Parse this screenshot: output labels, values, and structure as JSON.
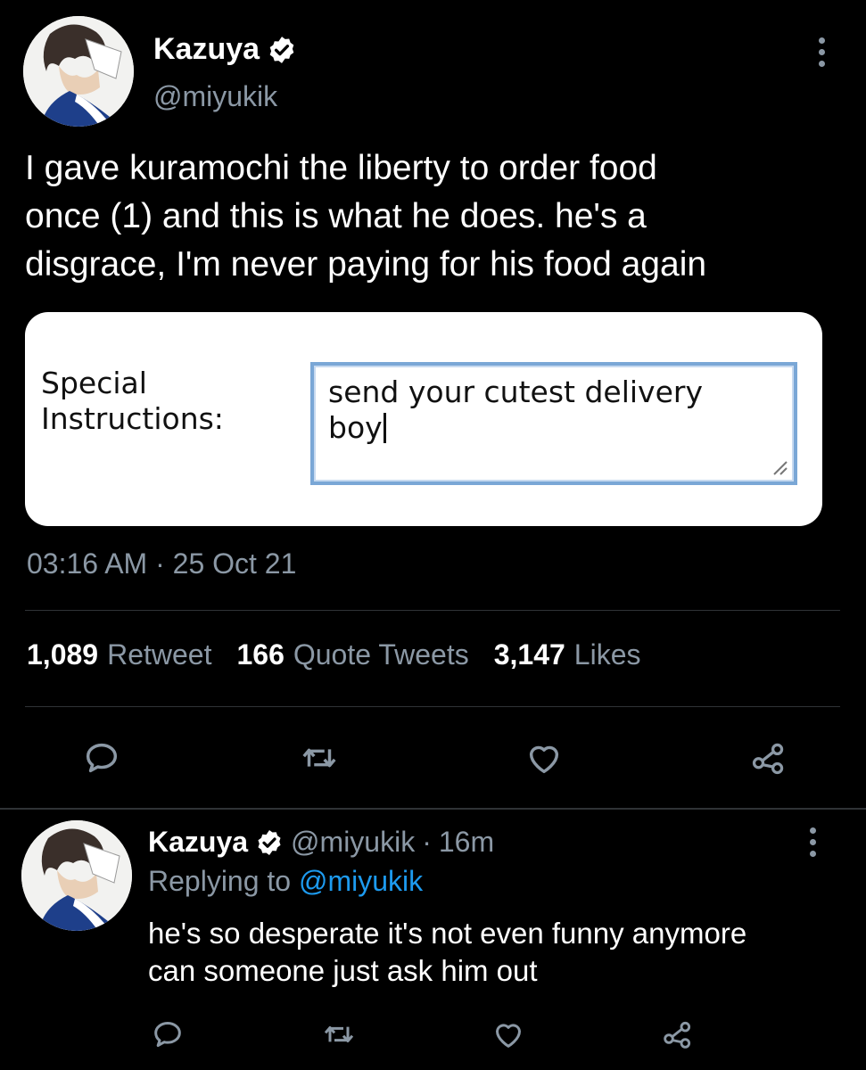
{
  "main_tweet": {
    "author_name": "Kazuya",
    "handle": "@miyukik",
    "text": "I gave kuramochi the liberty to order food\nonce (1) and this is what he does. he's a\ndisgrace, I'm never paying for his food again",
    "media": {
      "label": "Special\nInstructions:",
      "input_value": "send your cutest delivery\nboy"
    },
    "timestamp": "03:16 AM · 25 Oct 21",
    "stats": {
      "retweets_count": "1,089",
      "retweets_label": "Retweet",
      "quotes_count": "166",
      "quotes_label": "Quote Tweets",
      "likes_count": "3,147",
      "likes_label": "Likes"
    },
    "actions": [
      "reply-icon",
      "retweet-icon",
      "heart-icon",
      "share-icon"
    ]
  },
  "reply_tweet": {
    "author_name": "Kazuya",
    "handle": "@miyukik",
    "separator": "·",
    "time": "16m",
    "replying_to_label": "Replying to",
    "replying_to_handle": "@miyukik",
    "text": "he's so desperate it's not even funny anymore\ncan someone just ask him out",
    "actions": [
      "reply-icon",
      "retweet-icon",
      "heart-icon",
      "share-icon"
    ]
  },
  "colors": {
    "background": "#000000",
    "primary_text": "#ffffff",
    "secondary_text": "#8b98a5",
    "link": "#1d9bf0",
    "verified_badge": "#ffffff",
    "divider": "#2f3336"
  }
}
